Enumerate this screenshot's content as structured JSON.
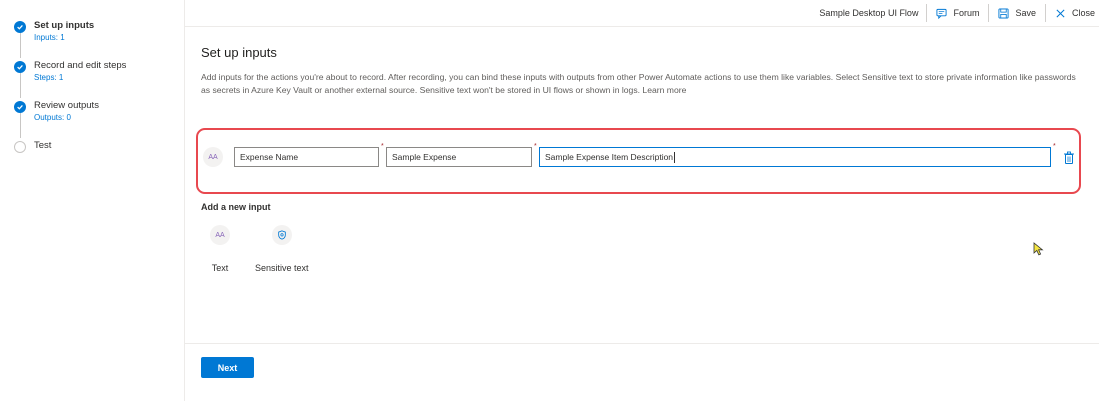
{
  "sidebar": {
    "steps": [
      {
        "title": "Set up inputs",
        "sub": "Inputs: 1",
        "state": "done",
        "current": true
      },
      {
        "title": "Record and edit steps",
        "sub": "Steps: 1",
        "state": "done",
        "current": false
      },
      {
        "title": "Review outputs",
        "sub": "Outputs: 0",
        "state": "done",
        "current": false
      },
      {
        "title": "Test",
        "sub": "",
        "state": "pending",
        "current": false
      }
    ]
  },
  "topbar": {
    "flow_name": "Sample Desktop UI Flow",
    "forum_label": "Forum",
    "save_label": "Save",
    "close_label": "Close"
  },
  "main": {
    "title": "Set up inputs",
    "description": "Add inputs for the actions you're about to record. After recording, you can bind these inputs with outputs from other Power Automate actions to use them like variables. Select Sensitive text to store private information like passwords as secrets in Azure Key Vault or another external source. Sensitive text won't be stored in UI flows or shown in logs.",
    "learn_more": "Learn more",
    "input_row": {
      "type_icon_text": "AA",
      "name_value": "Expense Name",
      "default_value": "Sample Expense",
      "description_value": "Sample Expense Item Description",
      "required_mark": "*"
    },
    "add_new_title": "Add a new input",
    "add_options": [
      {
        "label": "Text",
        "icon": "text-type-icon"
      },
      {
        "label": "Sensitive text",
        "icon": "shield-lock-icon"
      }
    ],
    "next_label": "Next"
  },
  "colors": {
    "accent": "#0078d4",
    "highlight_border": "#e8484f",
    "type_icon": "#8764b8"
  }
}
